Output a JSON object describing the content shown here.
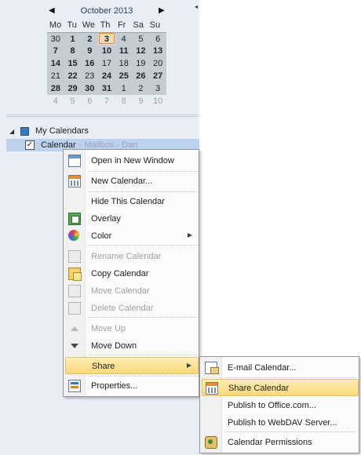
{
  "date_navigator": {
    "month_label": "October 2013",
    "weekdays": [
      "Mo",
      "Tu",
      "We",
      "Th",
      "Fr",
      "Sa",
      "Su"
    ],
    "weeks": [
      [
        "30",
        "1",
        "2",
        "3",
        "4",
        "5",
        "6"
      ],
      [
        "7",
        "8",
        "9",
        "10",
        "11",
        "12",
        "13"
      ],
      [
        "14",
        "15",
        "16",
        "17",
        "18",
        "19",
        "20"
      ],
      [
        "21",
        "22",
        "23",
        "24",
        "25",
        "26",
        "27"
      ],
      [
        "28",
        "29",
        "30",
        "31",
        "1",
        "2",
        "3"
      ],
      [
        "4",
        "5",
        "6",
        "7",
        "8",
        "9",
        "10"
      ]
    ],
    "today": "3"
  },
  "calendars": {
    "group_label": "My Calendars",
    "selected_item": {
      "label": "Calendar",
      "mailbox": "- Mailbox - Dan",
      "checked": true
    }
  },
  "context_menu": {
    "items": [
      {
        "label": "Open in New Window",
        "icon": "open-window-icon",
        "enabled": true
      },
      {
        "label": "New Calendar...",
        "icon": "new-calendar-icon",
        "enabled": true
      },
      {
        "label": "Hide This Calendar",
        "icon": "",
        "enabled": true
      },
      {
        "label": "Overlay",
        "icon": "overlay-icon",
        "enabled": true
      },
      {
        "label": "Color",
        "icon": "color-icon",
        "enabled": true,
        "submenu": true
      },
      {
        "label": "Rename Calendar",
        "icon": "rename-icon",
        "enabled": false
      },
      {
        "label": "Copy Calendar",
        "icon": "copy-icon",
        "enabled": true
      },
      {
        "label": "Move Calendar",
        "icon": "move-icon",
        "enabled": false
      },
      {
        "label": "Delete Calendar",
        "icon": "delete-icon",
        "enabled": false
      },
      {
        "label": "Move Up",
        "icon": "move-up-icon",
        "enabled": false
      },
      {
        "label": "Move Down",
        "icon": "move-down-icon",
        "enabled": true
      },
      {
        "label": "Share",
        "icon": "",
        "enabled": true,
        "submenu": true,
        "highlighted": true
      },
      {
        "label": "Properties...",
        "icon": "properties-icon",
        "enabled": true
      }
    ]
  },
  "share_submenu": {
    "items": [
      {
        "label": "E-mail Calendar...",
        "icon": "email-calendar-icon",
        "highlighted": false
      },
      {
        "label": "Share Calendar",
        "icon": "share-calendar-icon",
        "highlighted": true
      },
      {
        "label": "Publish to Office.com...",
        "icon": "",
        "highlighted": false
      },
      {
        "label": "Publish to WebDAV Server...",
        "icon": "",
        "highlighted": false
      },
      {
        "label": "Calendar Permissions",
        "icon": "permissions-icon",
        "highlighted": false
      }
    ]
  },
  "colors": {
    "nav_background": "#e9eef6",
    "selection": "#bdd2ee",
    "menu_highlight": "#fbd97a",
    "today_outline": "#e08a3c"
  }
}
